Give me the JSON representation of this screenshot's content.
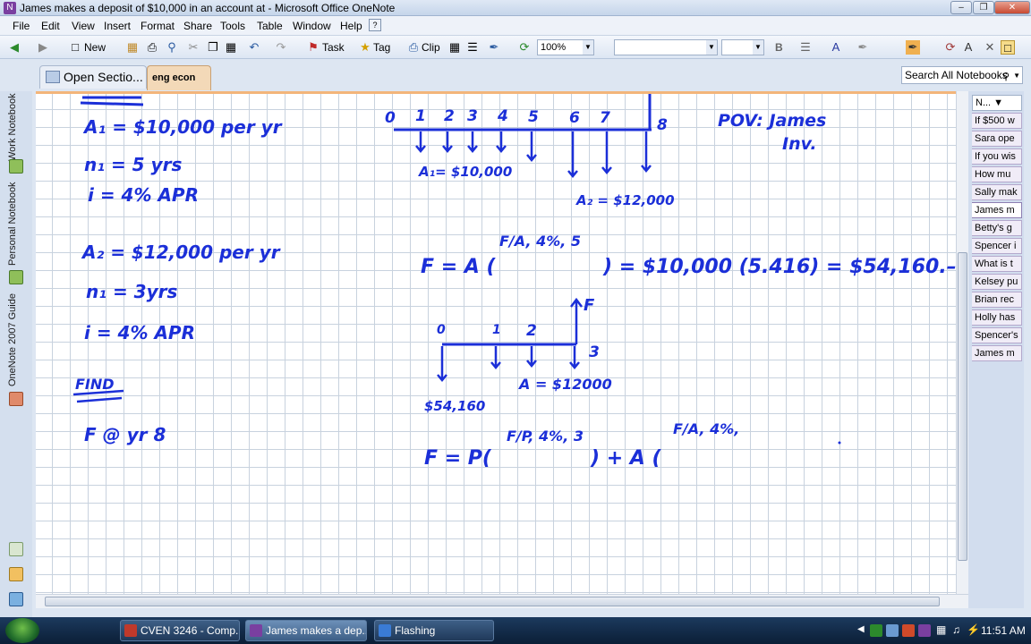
{
  "window": {
    "title": "James makes a deposit of $10,000 in an account at  - Microsoft Office OneNote",
    "minimize": "–",
    "restore": "❐",
    "close": "✕"
  },
  "menu": [
    "File",
    "Edit",
    "View",
    "Insert",
    "Format",
    "Share",
    "Tools",
    "Table",
    "Window",
    "Help"
  ],
  "toolbar": {
    "new_label": "New",
    "task_label": "Task",
    "tag_label": "Tag",
    "clip_label": "Clip",
    "zoom": "100%",
    "bold": "B",
    "font_name": "",
    "font_size": ""
  },
  "section_tabs": {
    "open_sections": "Open Sectio...",
    "active_section": "eng econ"
  },
  "search": {
    "placeholder": "Search All Notebooks"
  },
  "notebooks": [
    "Work Notebook",
    "Personal Notebook",
    "OneNote 2007 Guide"
  ],
  "pages": {
    "new_page": "N...",
    "items": [
      "If $500 w",
      "Sara ope",
      "If you wis",
      "How mu",
      "Sally mak",
      "James m",
      "Betty's g",
      "Spencer i",
      "What is t",
      "Kelsey pu",
      "Brian rec",
      "Holly has",
      "Spencer's",
      "James m"
    ],
    "active_index": 5
  },
  "notes": {
    "given1": [
      "A₁ = $10,000 per yr",
      "n₁ = 5 yrs",
      "i = 4% APR"
    ],
    "given2": [
      "A₂ = $12,000 per yr",
      "n₁ = 3yrs",
      "i = 4% APR"
    ],
    "find_heading": "FIND",
    "find_value": "F @ yr 8",
    "timeline1_ticks": [
      "0",
      "1",
      "2",
      "3",
      "4",
      "5",
      "6",
      "7",
      "8"
    ],
    "timeline1_a1": "A₁= $10,000",
    "timeline1_a2": "A₂ = $12,000",
    "pov": [
      "POV: James",
      "Inv."
    ],
    "eq1_left": "F = A (",
    "eq1_factor": "F/A, 4%, 5",
    "eq1_right": ") = $10,000 (5.416) = $54,160.–",
    "timeline2_ticks": [
      "0",
      "1",
      "2",
      "3"
    ],
    "timeline2_f": "F",
    "timeline2_a": "A = $12000",
    "timeline2_p": "$54,160",
    "eq2_left": "F = P(",
    "eq2_factor1": "F/P, 4%, 3",
    "eq2_mid": ") + A (",
    "eq2_factor2": "F/A, 4%,"
  },
  "taskbar": {
    "tasks": [
      "CVEN 3246 - Comp...",
      "James makes a dep...",
      "Flashing"
    ],
    "clock": "11:51 AM"
  }
}
